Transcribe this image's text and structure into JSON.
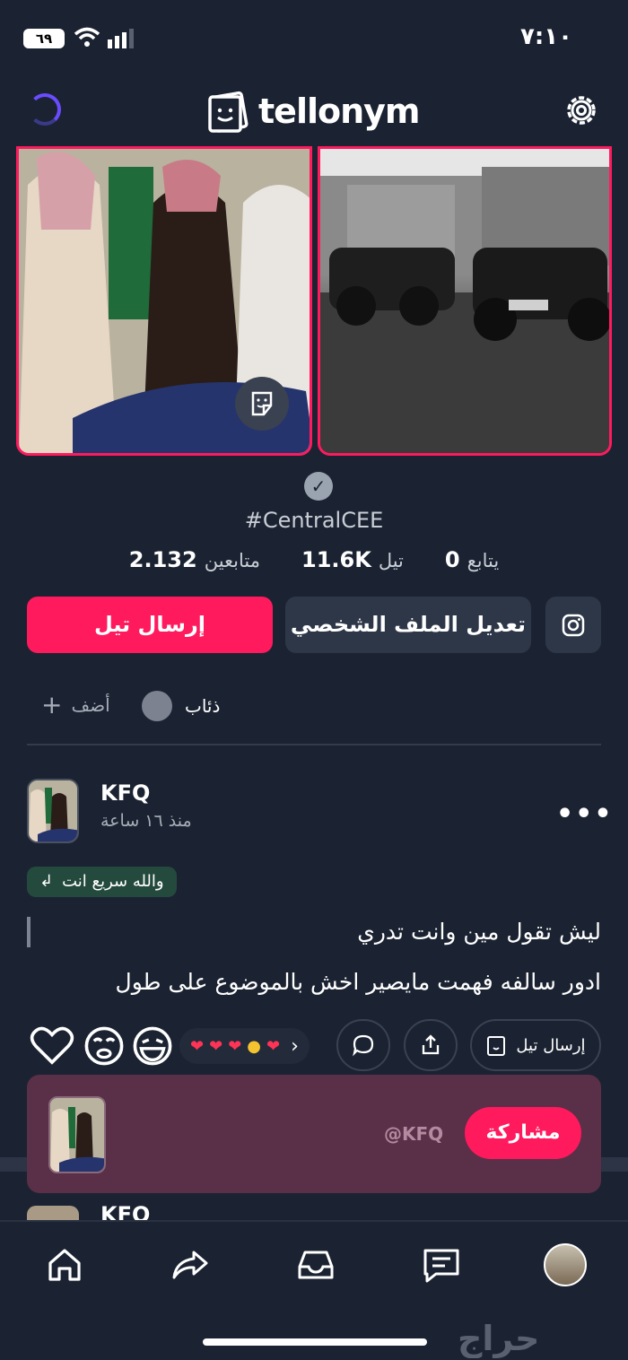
{
  "status_bar": {
    "battery": "٦٩",
    "time": "٧:١٠"
  },
  "header": {
    "logo_text": "tellonym"
  },
  "profile": {
    "handle": "#CentralCEE",
    "stats": [
      {
        "label": "متابعين",
        "value": "2.132"
      },
      {
        "label": "تيل",
        "value": "11.6K"
      },
      {
        "label": "يتابع",
        "value": "0"
      }
    ],
    "send_tell_label": "إرسال تيل",
    "edit_profile_label": "تعديل الملف الشخصي",
    "tags": {
      "wolf_label": "ذئاب",
      "add_label": "أضف"
    }
  },
  "post": {
    "author": "KFQ",
    "time": "منذ ١٦ ساعة",
    "reply_chip": "والله سريع انت",
    "line1": "ليش تقول مين وانت تدري",
    "line2": "ادور سالفه فهمت مايصير اخش بالموضوع على طول",
    "send_tell_label": "إرسال تيل",
    "more_label": "•••"
  },
  "share_card": {
    "handle": "@KFQ",
    "button_label": "مشاركة"
  },
  "next_post": {
    "author": "KFQ"
  },
  "watermark": "حراج",
  "colors": {
    "background": "#1b2332",
    "accent": "#ff1a5e",
    "card": "#2e3748",
    "share_card": "#5a2f48"
  }
}
